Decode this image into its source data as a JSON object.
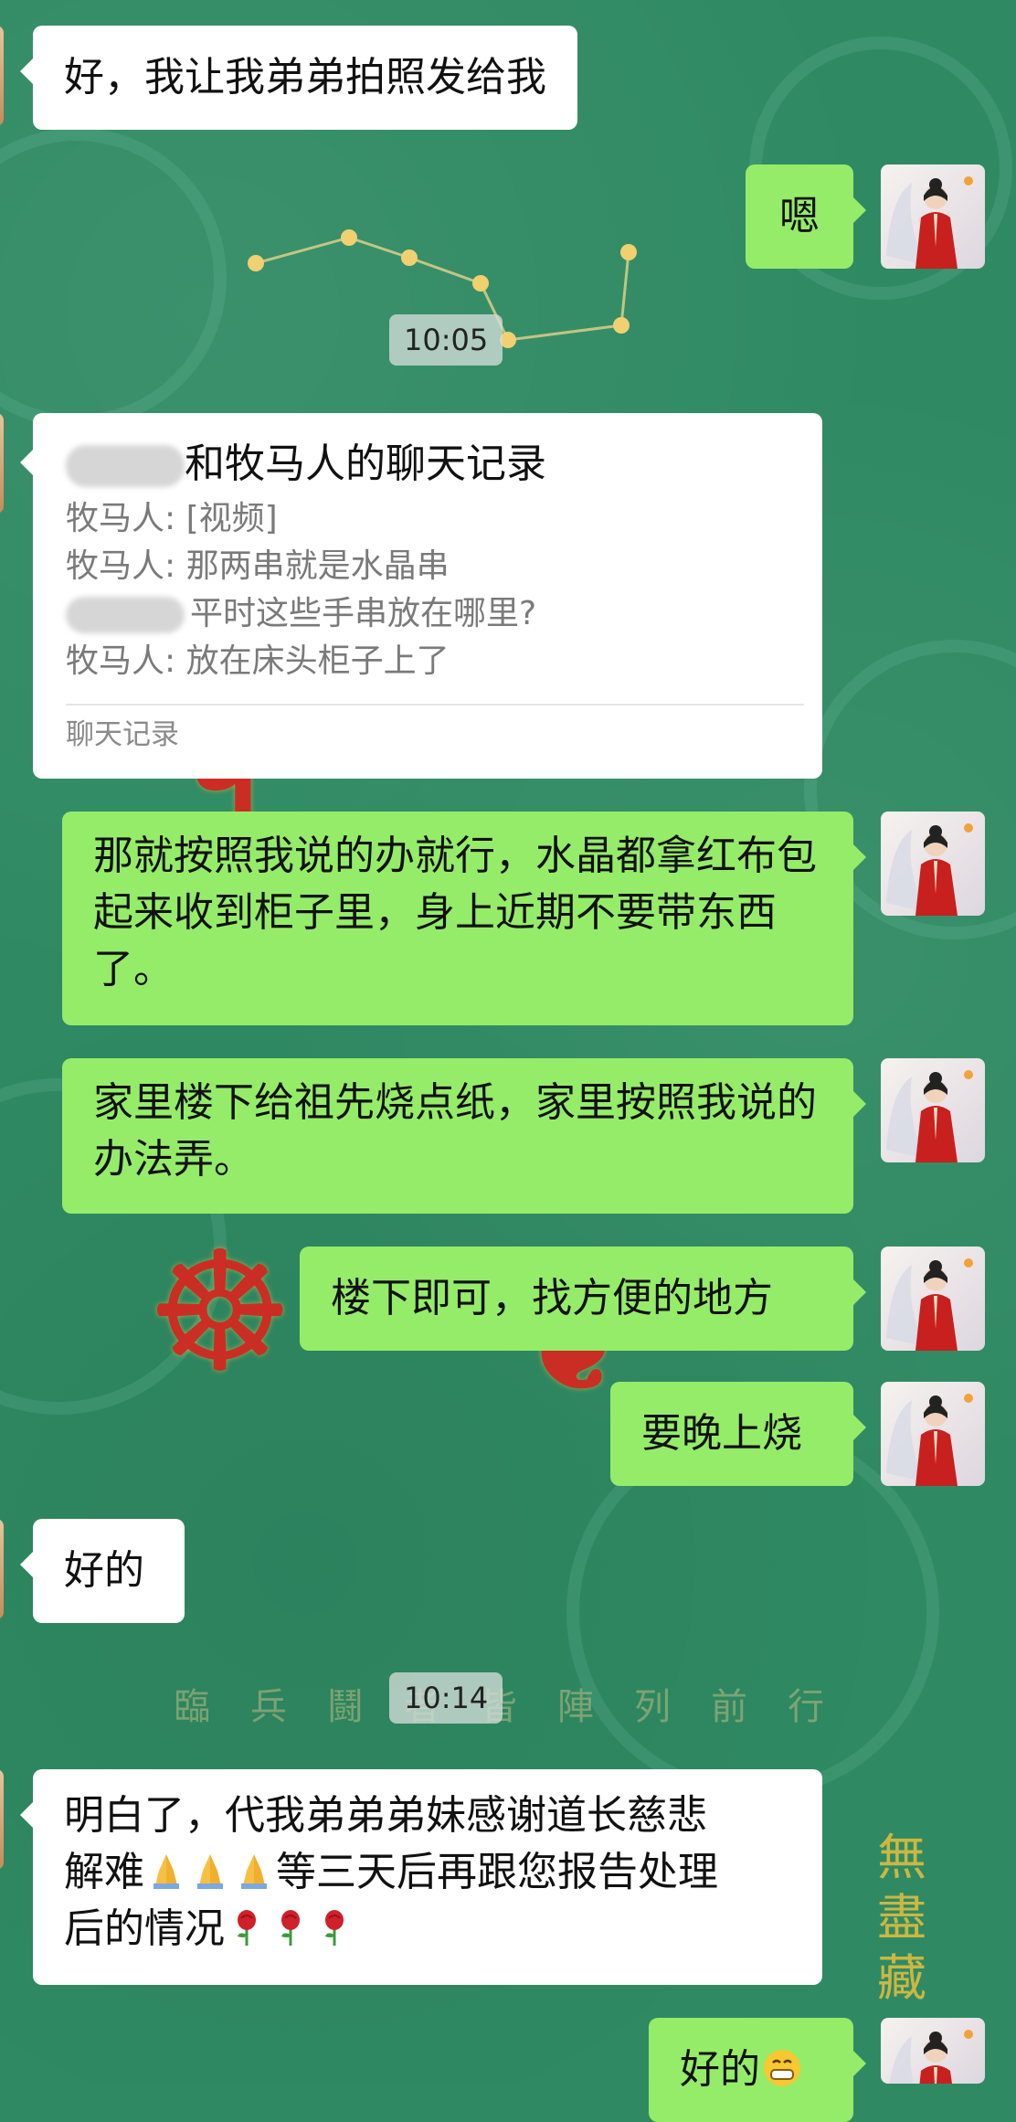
{
  "messages": [
    {
      "text": "好，我让我弟弟拍照发给我"
    },
    {
      "text": "嗯"
    },
    {
      "text": "那就按照我说的办就行，水晶都拿红布包起来收到柜子里，身上近期不要带东西了。"
    },
    {
      "text": "家里楼下给祖先烧点纸，家里按照我说的办法弄。"
    },
    {
      "text": "楼下即可，找方便的地方"
    },
    {
      "text": "要晚上烧"
    },
    {
      "text": "好的"
    },
    {
      "text_a": "明白了，代我弟弟弟妹感谢道长慈悲",
      "text_b": "解难",
      "text_c": "等三天后再跟您报告处理",
      "text_d": "后的情况"
    },
    {
      "text": "好的"
    }
  ],
  "times": [
    "10:05",
    "10:14"
  ],
  "chat_record": {
    "title": "和牧马人的聊天记录",
    "lines": [
      {
        "sender": "牧马人",
        "sep": ": ",
        "content": "[视频]"
      },
      {
        "sender": "牧马人",
        "sep": ": ",
        "content": "那两串就是水晶串"
      },
      {
        "sender": "",
        "sep": "",
        "content": "平时这些手串放在哪里?"
      },
      {
        "sender": "牧马人",
        "sep": ": ",
        "content": "放在床头柜子上了"
      }
    ],
    "footer": "聊天记录"
  },
  "colors": {
    "outgoing_bubble": "#95ec69",
    "incoming_bubble": "#ffffff",
    "wallpaper": "#2f8a63"
  },
  "icons": [
    "folded-hands-emoji",
    "rose-emoji",
    "grinning-emoji"
  ]
}
